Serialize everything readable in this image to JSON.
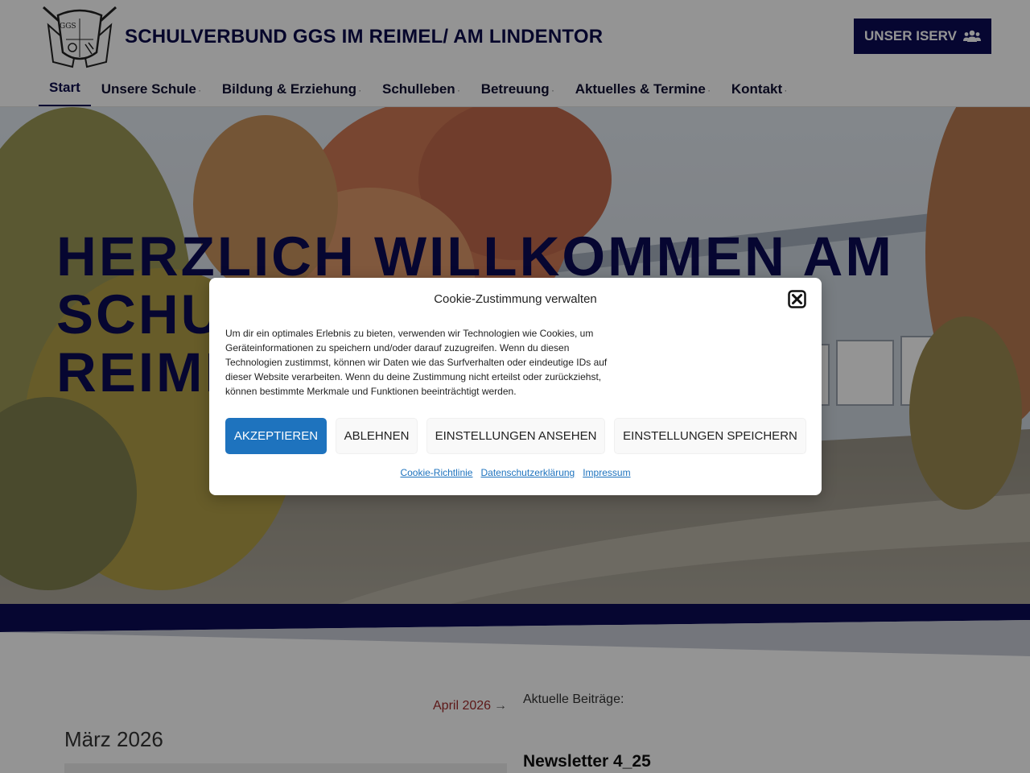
{
  "site": {
    "title": "SCHULVERBUND GGS IM REIMEL/ AM LINDENTOR",
    "iserv_button": "UNSER ISERV",
    "logo_text": "GGS"
  },
  "nav": {
    "items": [
      {
        "label": "Start"
      },
      {
        "label": "Unsere Schule"
      },
      {
        "label": "Bildung & Erziehung"
      },
      {
        "label": "Schulleben"
      },
      {
        "label": "Betreuung"
      },
      {
        "label": "Aktuelles & Termine"
      },
      {
        "label": "Kontakt"
      }
    ]
  },
  "hero": {
    "title": "HERZLICH WILLKOMMEN AM SCHULVERBUND GGS IM REIMEL/ AM LINDENTOR"
  },
  "content": {
    "next_month_link": "April 2026",
    "next_arrow": "→",
    "month_title": "März 2026",
    "sidebar_heading": "Aktuelle Beiträge:",
    "post_title": "Newsletter 4_25"
  },
  "cookie": {
    "title": "Cookie-Zustimmung verwalten",
    "text": "Um dir ein optimales Erlebnis zu bieten, verwenden wir Technologien wie Cookies, um Geräteinformationen zu speichern und/oder darauf zuzugreifen. Wenn du diesen Technologien zustimmst, können wir Daten wie das Surfverhalten oder eindeutige IDs auf dieser Website verarbeiten. Wenn du deine Zustimmung nicht erteilst oder zurückziehst, können bestimmte Merkmale und Funktionen beeinträchtigt werden.",
    "accept": "AKZEPTIEREN",
    "deny": "ABLEHNEN",
    "view_prefs": "EINSTELLUNGEN ANSEHEN",
    "save_prefs": "EINSTELLUNGEN SPEICHERN",
    "links": {
      "cookie_policy": "Cookie-Richtlinie",
      "privacy": "Datenschutzerklärung",
      "imprint": "Impressum"
    }
  },
  "colors": {
    "brand_navy": "#0b0b55",
    "accept_blue": "#1e73be",
    "link_red": "#a02b2b"
  }
}
